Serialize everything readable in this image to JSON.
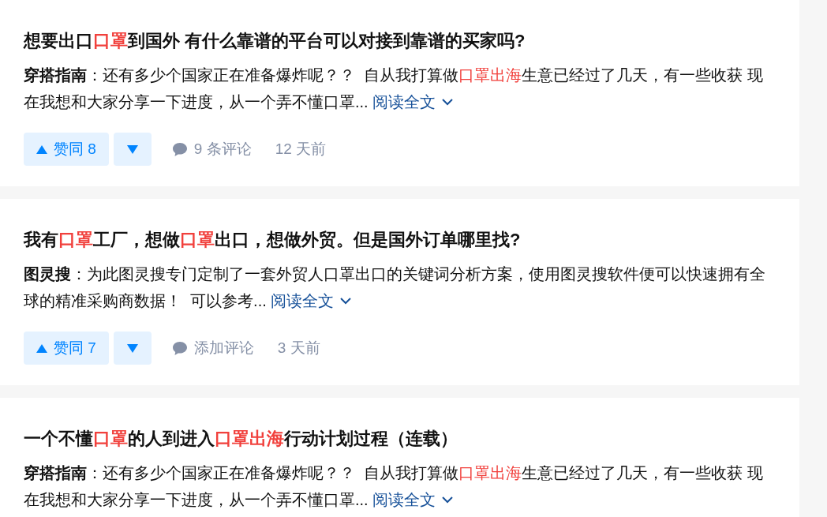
{
  "results": [
    {
      "title": [
        {
          "text": "想要出口",
          "highlight": false
        },
        {
          "text": "口罩",
          "highlight": true
        },
        {
          "text": "到国外 有什么靠谱的平台可以对接到靠谱的买家吗?",
          "highlight": false
        }
      ],
      "excerpt": {
        "author": "穿搭指南",
        "segments": [
          {
            "text": "：还有多少个国家正在准备爆炸呢？？  自从我打算做",
            "highlight": false
          },
          {
            "text": "口罩出海",
            "highlight": true
          },
          {
            "text": "生意已经过了几天，有一些收获 现在我想和大家分享一下进度，从一个弄不懂口罩...",
            "highlight": false
          }
        ],
        "read_more": "阅读全文"
      },
      "actions": {
        "upvote": "赞同 8",
        "comment": "9 条评论",
        "time": "12 天前"
      }
    },
    {
      "title": [
        {
          "text": "我有",
          "highlight": false
        },
        {
          "text": "口罩",
          "highlight": true
        },
        {
          "text": "工厂，想做",
          "highlight": false
        },
        {
          "text": "口罩",
          "highlight": true
        },
        {
          "text": "出口，想做外贸。但是国外订单哪里找?",
          "highlight": false
        }
      ],
      "excerpt": {
        "author": "图灵搜",
        "segments": [
          {
            "text": "：为此图灵搜专门定制了一套外贸人口罩出口的关键词分析方案，使用图灵搜软件便可以快速拥有全球的精准采购商数据！  可以参考...",
            "highlight": false
          }
        ],
        "read_more": "阅读全文"
      },
      "actions": {
        "upvote": "赞同 7",
        "comment": "添加评论",
        "time": "3 天前"
      }
    },
    {
      "title": [
        {
          "text": "一个不懂",
          "highlight": false
        },
        {
          "text": "口罩",
          "highlight": true
        },
        {
          "text": "的人到进入",
          "highlight": false
        },
        {
          "text": "口罩出海",
          "highlight": true
        },
        {
          "text": "行动计划过程（连载）",
          "highlight": false
        }
      ],
      "excerpt": {
        "author": "穿搭指南",
        "segments": [
          {
            "text": "：还有多少个国家正在准备爆炸呢？？  自从我打算做",
            "highlight": false
          },
          {
            "text": "口罩出海",
            "highlight": true
          },
          {
            "text": "生意已经过了几天，有一些收获 现在我想和大家分享一下进度，从一个弄不懂口罩...",
            "highlight": false
          }
        ],
        "read_more": "阅读全文"
      }
    }
  ]
}
